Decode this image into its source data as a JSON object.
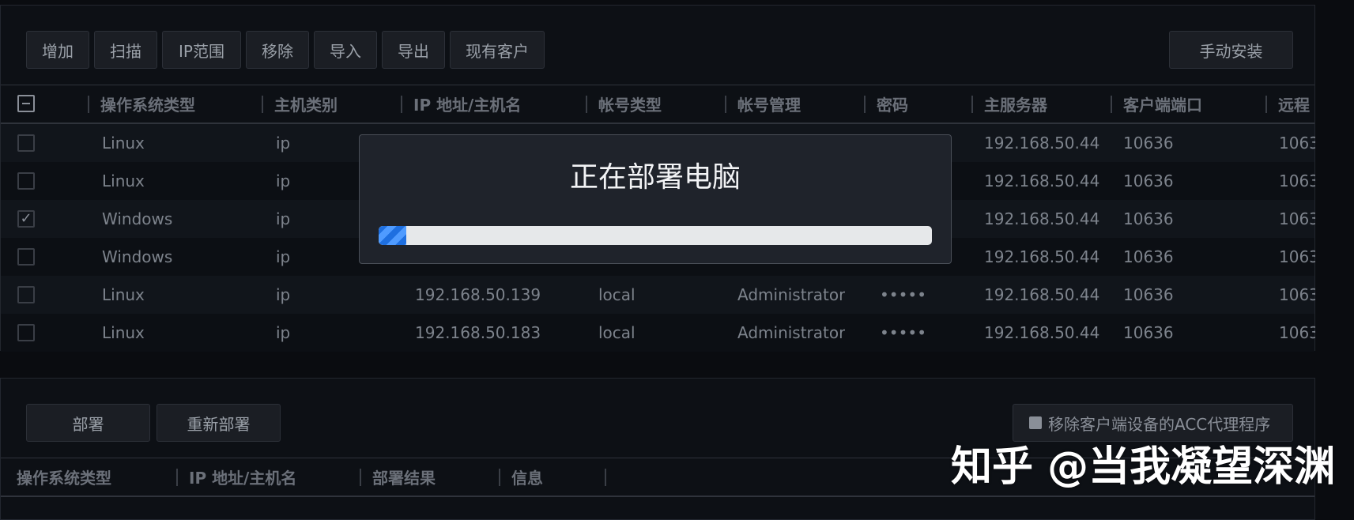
{
  "toolbar": {
    "buttons": [
      "增加",
      "扫描",
      "IP范围",
      "移除",
      "导入",
      "导出",
      "现有客户"
    ],
    "manual_install": "手动安装"
  },
  "table": {
    "columns": [
      "操作系统类型",
      "主机类别",
      "IP 地址/主机名",
      "帐号类型",
      "帐号管理",
      "密码",
      "主服务器",
      "客户端端口",
      "远程"
    ],
    "rows": [
      {
        "os": "Linux",
        "host": "ip",
        "ip": "",
        "account_type": "",
        "account": "",
        "password": "",
        "server": "192.168.50.44",
        "client_port": "10636",
        "remote": "1063",
        "checked": false
      },
      {
        "os": "Linux",
        "host": "ip",
        "ip": "",
        "account_type": "",
        "account": "",
        "password": "",
        "server": "192.168.50.44",
        "client_port": "10636",
        "remote": "1063",
        "checked": false
      },
      {
        "os": "Windows",
        "host": "ip",
        "ip": "",
        "account_type": "",
        "account": "",
        "password": "",
        "server": "192.168.50.44",
        "client_port": "10636",
        "remote": "1063",
        "checked": true
      },
      {
        "os": "Windows",
        "host": "ip",
        "ip": "",
        "account_type": "",
        "account": "",
        "password": "",
        "server": "192.168.50.44",
        "client_port": "10636",
        "remote": "1063",
        "checked": false
      },
      {
        "os": "Linux",
        "host": "ip",
        "ip": "192.168.50.139",
        "account_type": "local",
        "account": "Administrator",
        "password": "•••••",
        "server": "192.168.50.44",
        "client_port": "10636",
        "remote": "1063",
        "checked": false
      },
      {
        "os": "Linux",
        "host": "ip",
        "ip": "192.168.50.183",
        "account_type": "local",
        "account": "Administrator",
        "password": "•••••",
        "server": "192.168.50.44",
        "client_port": "10636",
        "remote": "1063",
        "checked": false
      }
    ]
  },
  "modal": {
    "title": "正在部署电脑",
    "progress_percent": 5
  },
  "deploy": {
    "deploy_label": "部署",
    "redeploy_label": "重新部署",
    "remove_acc_label": "移除客户端设备的ACC代理程序",
    "columns": [
      "操作系统类型",
      "IP 地址/主机名",
      "部署结果",
      "信息"
    ]
  },
  "watermark": "知乎 @当我凝望深渊"
}
